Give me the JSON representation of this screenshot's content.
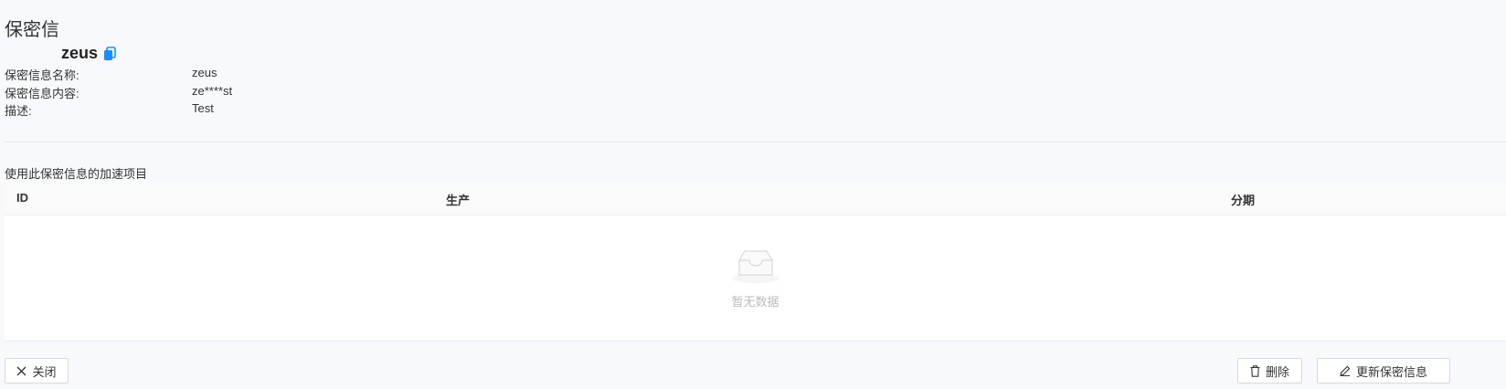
{
  "page": {
    "title": "保密信"
  },
  "secret": {
    "name": "zeus",
    "fields": [
      {
        "label": "保密信息名称:",
        "value": "zeus"
      },
      {
        "label": "保密信息内容:",
        "value": "ze****st"
      },
      {
        "label": "描述:",
        "value": "Test"
      }
    ]
  },
  "projects": {
    "section_title": "使用此保密信息的加速项目",
    "columns": [
      "ID",
      "生产",
      "分期"
    ],
    "rows": [],
    "empty_text": "暂无数据"
  },
  "footer": {
    "close_label": "关闭",
    "delete_label": "删除",
    "update_label": "更新保密信息"
  },
  "icons": {
    "copy": "copy-icon",
    "close": "close-icon",
    "delete": "trash-icon",
    "update": "edit-icon",
    "empty": "empty-inbox-icon"
  },
  "colors": {
    "accent": "#1890ff"
  }
}
